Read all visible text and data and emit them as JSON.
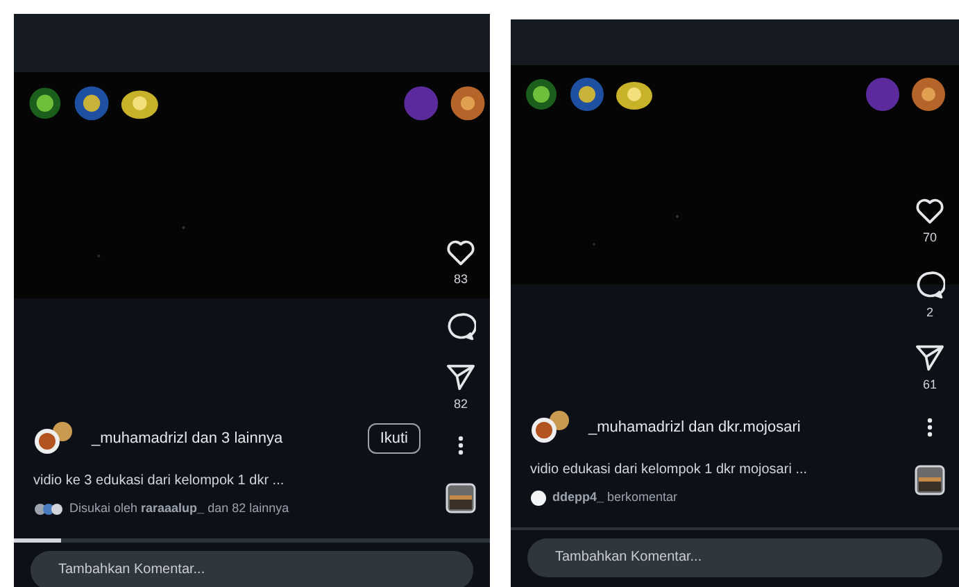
{
  "posts": [
    {
      "actions": [
        {
          "kind": "like",
          "count": "83"
        },
        {
          "kind": "comment"
        },
        {
          "kind": "share",
          "count": "82"
        },
        {
          "kind": "more"
        }
      ],
      "author": "_muhamadrizl dan 3 lainnya",
      "follow_button": "Ikuti",
      "caption": "vidio ke 3 edukasi dari kelompok 1 dkr ...",
      "activity": {
        "kind": "likes",
        "text": "Disukai oleh **raraaalup_** dan 82 lainnya"
      },
      "progress": {
        "level": 0.1
      },
      "comment_field": {
        "placeholder": "Tambahkan Komentar..."
      }
    },
    {
      "actions": [
        {
          "kind": "like",
          "count": "70"
        },
        {
          "kind": "comment",
          "count": "2"
        },
        {
          "kind": "share",
          "count": "61"
        },
        {
          "kind": "more"
        }
      ],
      "author": "_muhamadrizl dan dkr.mojosari",
      "caption": "vidio edukasi dari kelompok 1 dkr mojosari ...",
      "activity": {
        "kind": "comment",
        "text": "**ddepp4_** berkomentar"
      },
      "comment_field": {
        "placeholder": "Tambahkan Komentar..."
      }
    }
  ]
}
